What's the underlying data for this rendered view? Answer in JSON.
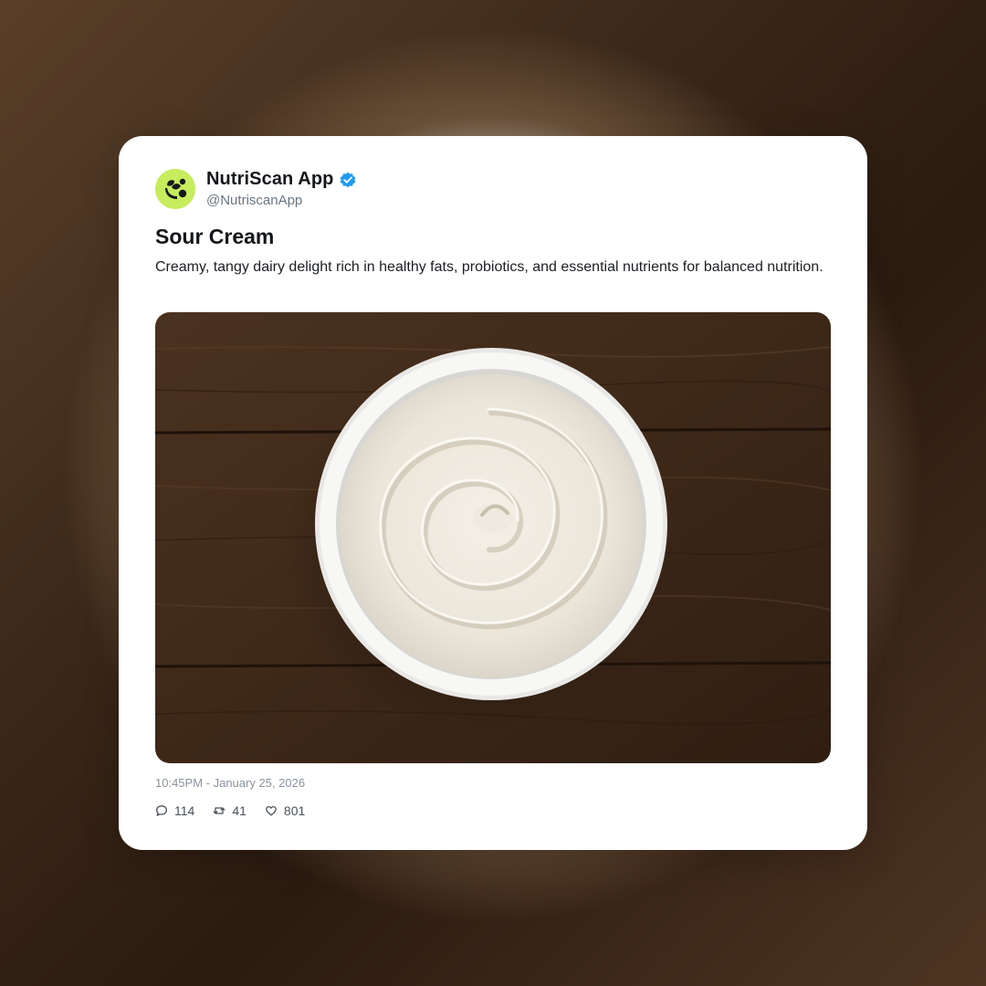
{
  "post": {
    "author_name": "NutriScan App",
    "handle": "@NutriscanApp",
    "verified_icon": "verified-badge-icon",
    "title": "Sour Cream",
    "description": "Creamy, tangy dairy delight rich in healthy fats, probiotics, and essential nutrients for balanced nutrition.",
    "image_subject": "bowl of sour cream on wooden table",
    "timestamp": "10:45PM - January 25, 2026",
    "stats": {
      "replies": "114",
      "reposts": "41",
      "likes": "801"
    }
  },
  "colors": {
    "avatar_bg": "#c7ec5d",
    "verified_blue": "#1d9bf0",
    "card_bg": "#ffffff",
    "text_primary": "#14171a",
    "text_secondary": "#6b7580"
  }
}
